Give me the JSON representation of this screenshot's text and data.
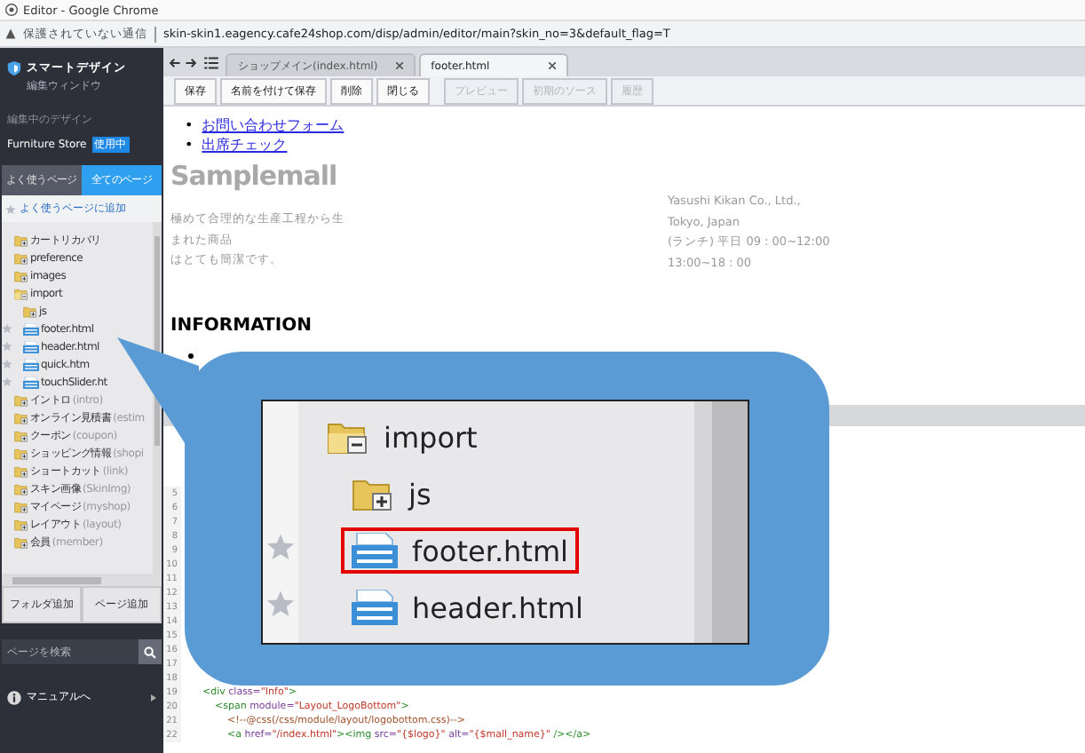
{
  "window": {
    "title": "Editor - Google Chrome"
  },
  "address_bar": {
    "security": "保護されていない通信",
    "url": "skin-skin1.eagency.cafe24shop.com/disp/admin/editor/main?skin_no=3&default_flag=T"
  },
  "sidebar": {
    "title": "スマートデザイン",
    "subtitle": "編集ウィンドウ",
    "design_label": "編集中のデザイン",
    "design_name": "Furniture Store",
    "design_badge": "使用中",
    "tabs": [
      {
        "label": "よく使うページ",
        "selected": false
      },
      {
        "label": "全てのページ",
        "selected": true
      }
    ],
    "add_favorite": "よく使うページに追加",
    "tree": [
      {
        "kind": "folder",
        "name": "カートリカバリ",
        "expanded": false
      },
      {
        "kind": "folder",
        "name": "preference",
        "expanded": false
      },
      {
        "kind": "folder",
        "name": "images",
        "expanded": false
      },
      {
        "kind": "folder",
        "name": "import",
        "expanded": true,
        "children": [
          {
            "kind": "folder",
            "name": "js",
            "expanded": false
          },
          {
            "kind": "file",
            "name": "footer.html",
            "favorite": true
          },
          {
            "kind": "file",
            "name": "header.html",
            "favorite": true
          },
          {
            "kind": "file",
            "name": "quick.htm",
            "favorite": true
          },
          {
            "kind": "file",
            "name": "touchSlider.ht",
            "favorite": true
          }
        ]
      },
      {
        "kind": "folder",
        "name": "イントロ",
        "note": "(intro)",
        "expanded": false
      },
      {
        "kind": "folder",
        "name": "オンライン見積書",
        "note": "(estim",
        "expanded": false
      },
      {
        "kind": "folder",
        "name": "クーポン",
        "note": "(coupon)",
        "expanded": false
      },
      {
        "kind": "folder",
        "name": "ショッピング情報",
        "note": "(shopi",
        "expanded": false
      },
      {
        "kind": "folder",
        "name": "ショートカット",
        "note": "(link)",
        "expanded": false
      },
      {
        "kind": "folder",
        "name": "スキン画像",
        "note": "(SkinImg)",
        "expanded": false
      },
      {
        "kind": "folder",
        "name": "マイページ",
        "note": "(myshop)",
        "expanded": false
      },
      {
        "kind": "folder",
        "name": "レイアウト",
        "note": "(layout)",
        "expanded": false
      },
      {
        "kind": "folder",
        "name": "会員",
        "note": "(member)",
        "expanded": false
      }
    ],
    "buttons": [
      "フォルダ追加",
      "ページ追加"
    ],
    "search": {
      "placeholder": "ページを検索"
    },
    "manual_link": "マニュアルへ"
  },
  "editor_tabs": [
    {
      "label": "ショップメイン(index.html)",
      "selected": false
    },
    {
      "label": "footer.html",
      "selected": true
    }
  ],
  "toolbar": [
    {
      "label": "保存",
      "disabled": false
    },
    {
      "label": "名前を付けて保存",
      "disabled": false
    },
    {
      "label": "削除",
      "disabled": false
    },
    {
      "label": "閉じる",
      "disabled": false
    },
    {
      "label": "プレビュー",
      "disabled": true
    },
    {
      "label": "初期のソース",
      "disabled": true
    },
    {
      "label": "履歴",
      "disabled": true
    }
  ],
  "preview": {
    "links": [
      {
        "bullet": "•",
        "text": "お問い合わせフォーム"
      },
      {
        "bullet": "•",
        "text": "出席チェック"
      }
    ],
    "logo": "Samplemall",
    "description": [
      "極めて合理的な生産工程から生",
      "まれた商品",
      "はとても簡潔です。"
    ],
    "company": [
      "Yasushi Kikan Co., Ltd.,",
      "Tokyo, Japan",
      "(ランチ) 平日 09 : 00~12:00",
      "13:00~18 : 00"
    ],
    "heading": "INFORMATION"
  },
  "code": {
    "lines": [
      {
        "number": "5"
      },
      {
        "number": "6"
      },
      {
        "number": "7"
      },
      {
        "number": "8"
      },
      {
        "number": "9"
      },
      {
        "number": "10"
      },
      {
        "number": "11"
      },
      {
        "number": "12"
      },
      {
        "number": "13"
      },
      {
        "number": "14"
      },
      {
        "number": "15"
      },
      {
        "number": "16"
      },
      {
        "number": "17"
      },
      {
        "number": "18"
      },
      {
        "number": "19",
        "tokens": [
          {
            "kind": "tag",
            "text": "<div "
          },
          {
            "kind": "attr",
            "text": "class="
          },
          {
            "kind": "value",
            "text": "\"Info\""
          },
          {
            "kind": "tag",
            "text": ">"
          }
        ]
      },
      {
        "number": "20",
        "tokens": [
          {
            "kind": "tag",
            "text": "    <span "
          },
          {
            "kind": "attr",
            "text": "module="
          },
          {
            "kind": "value",
            "text": "\"Layout_LogoBottom\""
          },
          {
            "kind": "tag",
            "text": ">"
          }
        ]
      },
      {
        "number": "21",
        "tokens": [
          {
            "kind": "comment",
            "text": "        <!--@css(/css/module/layout/logobottom.css)-->"
          }
        ]
      },
      {
        "number": "22",
        "tokens": [
          {
            "kind": "tag",
            "text": "        <a "
          },
          {
            "kind": "attr",
            "text": "href="
          },
          {
            "kind": "value",
            "text": "\"/index.html\""
          },
          {
            "kind": "tag",
            "text": "><img "
          },
          {
            "kind": "attr",
            "text": "src="
          },
          {
            "kind": "value",
            "text": "\"{$logo}\""
          },
          {
            "kind": "attr",
            "text": " alt="
          },
          {
            "kind": "value",
            "text": "\"{$mall_name}\""
          },
          {
            "kind": "tag",
            "text": " /></a>"
          }
        ]
      }
    ]
  },
  "callout": {
    "items": [
      {
        "kind": "folder",
        "name": "import",
        "expanded": true,
        "highlighted": false
      },
      {
        "kind": "folder",
        "name": "js",
        "expanded": false,
        "highlighted": false
      },
      {
        "kind": "file",
        "name": "footer.html",
        "favorite": true,
        "highlighted": true
      },
      {
        "kind": "file",
        "name": "header.html",
        "favorite": true,
        "highlighted": false
      }
    ]
  }
}
